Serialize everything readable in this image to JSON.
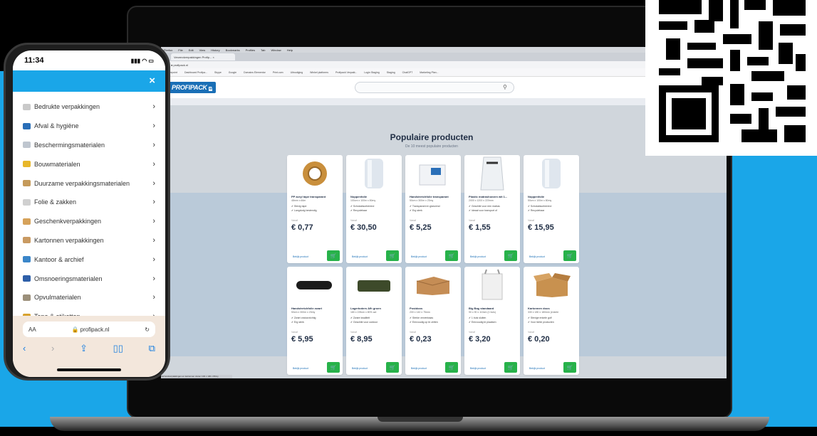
{
  "phone": {
    "time": "11:34",
    "signal": "▮▮▮ ◠ ▭",
    "close_label": "×",
    "menu": [
      {
        "label": "Bedrukte verpakkingen",
        "color": "#c9c9c9"
      },
      {
        "label": "Afval & hygiëne",
        "color": "#2a6fb8"
      },
      {
        "label": "Beschermingsmaterialen",
        "color": "#bfc6cf"
      },
      {
        "label": "Bouwmaterialen",
        "color": "#e8b72a"
      },
      {
        "label": "Duurzame verpakkingsmaterialen",
        "color": "#c59a5a"
      },
      {
        "label": "Folie & zakken",
        "color": "#d0d0d0"
      },
      {
        "label": "Geschenkverpakkingen",
        "color": "#d6a25a"
      },
      {
        "label": "Kartonnen verpakkingen",
        "color": "#c99a62"
      },
      {
        "label": "Kantoor & archief",
        "color": "#3b86c9"
      },
      {
        "label": "Omsnoeringsmaterialen",
        "color": "#2e5fa8"
      },
      {
        "label": "Opvulmaterialen",
        "color": "#9b8f7a"
      },
      {
        "label": "Tape & etiketten",
        "color": "#d8a22e"
      }
    ],
    "browser": {
      "aa": "AA",
      "host": "🔒 profipack.nl",
      "reload": "↻",
      "nav": [
        "‹",
        "›",
        "⇪",
        "▯▯",
        "⧉"
      ]
    }
  },
  "browser": {
    "menubar": [
      "Firefox",
      "File",
      "Edit",
      "View",
      "History",
      "Bookmarks",
      "Profiles",
      "Tab",
      "Window",
      "Help"
    ],
    "tab_title": "Verzendverpakkingen Profip... ×",
    "url": "● profipack.nl",
    "bookmarks": [
      "Sharepoint",
      "Dashboard Profipa...",
      "Skype",
      "Google",
      "Domains Elementor",
      "Print.com",
      "Uitnodiging",
      "Winkel platforms",
      "Profipack Verpakt...",
      "Login Staging",
      "Staging",
      "ChatGPT",
      "Marketing Plan..."
    ]
  },
  "site": {
    "logo": "PROFIPACK",
    "logo_suffix": "nl",
    "search_icon": "⚲",
    "section_title": "Populaire producten",
    "section_subtitle": "De 10 meest populaire producten",
    "vanaf_label": "Vanaf",
    "link_label": "Bekijk product",
    "cart_icon": "🛒",
    "products": [
      {
        "name": "PP acryl tape transparant",
        "dims": "48mm x 66m",
        "f1": "✔ Stevig tape",
        "f2": "✔ Langdurig bestendig",
        "price": "€ 0,77",
        "kind": "tape"
      },
      {
        "name": "Noppenfolie",
        "dims": "100cm x 100m x 80my",
        "f1": "✔ Schokabsorberend",
        "f2": "✔ Recyclebaar",
        "price": "€ 30,50",
        "kind": "roll"
      },
      {
        "name": "Handstretchfolie transparant",
        "dims": "50cm x 300m x 23my",
        "f1": "✔ Transparant en glanzend",
        "f2": "✔ Erg sterk",
        "price": "€ 5,25",
        "kind": "box-white"
      },
      {
        "name": "Plastic matrashoezen wit 1...",
        "dims": "2000 x 1200 x 220mm",
        "f1": "✔ Geschikt voor een matras",
        "f2": "✔ Ideaal voor transport of",
        "price": "€ 1,55",
        "kind": "bag"
      },
      {
        "name": "Noppenfolie",
        "dims": "50cm x 100m x 80my",
        "f1": "✔ Schokabsorberend",
        "f2": "✔ Recyclebaar",
        "price": "€ 15,95",
        "kind": "roll"
      },
      {
        "name": "Handstretchfolie zwart",
        "dims": "50cm x 300m x 23my",
        "f1": "✔ Zwart ondoorzichtig",
        "f2": "✔ Erg sterk",
        "price": "€ 5,95",
        "kind": "black-roll"
      },
      {
        "name": "Lagerboters Afh groen",
        "dims": "180 x 225cm x 80% act",
        "f1": "✔ Zware kwaliteit",
        "f2": "✔ Geschikt voor outdoor",
        "price": "€ 8,95",
        "kind": "green"
      },
      {
        "name": "Postdoos",
        "dims": "200 x 140 x 75mm",
        "f1": "✔ Sterke vervenbaas",
        "f2": "✔ Eenvoudig op te zetten",
        "price": "€ 0,23",
        "kind": "postbox"
      },
      {
        "name": "Big Bag standaard",
        "dims": "90 x 90 x 110cm (1 buis)",
        "f1": "✔ 1 buis sluiten",
        "f2": "✔ Eenvoudig te plaatsen",
        "price": "€ 3,20",
        "kind": "bigbag"
      },
      {
        "name": "Kartonnen doos",
        "dims": "330 x 180 x 180mm (enkele",
        "f1": "✔ Stevige enkele golf",
        "f2": "✔ Voor lichte producten",
        "price": "€ 0,20",
        "kind": "carton"
      }
    ]
  },
  "status_text": "Verzendverpakkingen en kartonnen dozen 100 x 100 x 80my"
}
